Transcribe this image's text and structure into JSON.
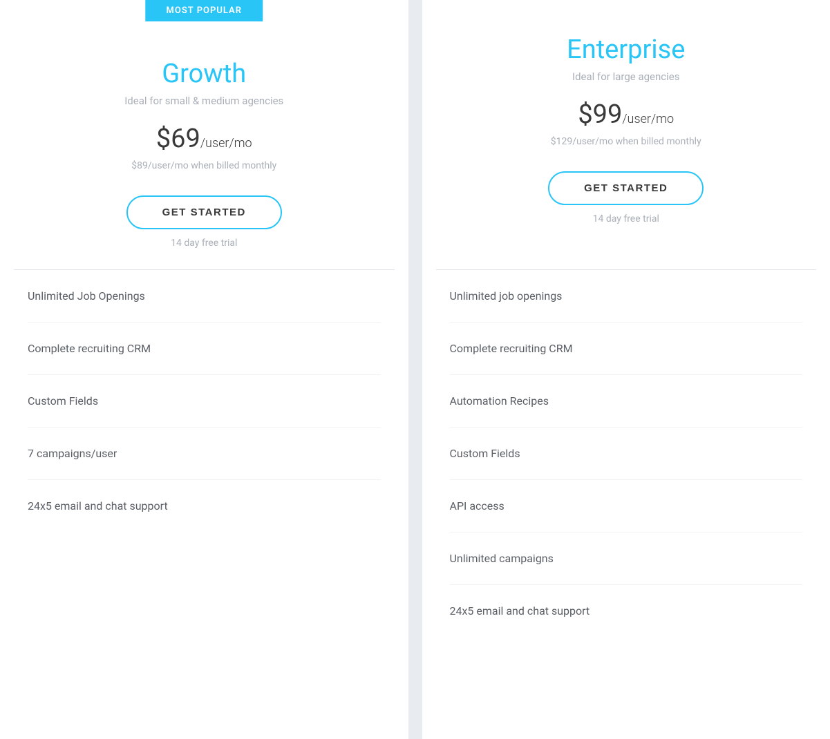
{
  "plans": [
    {
      "id": "growth",
      "name": "Growth",
      "badge": "MOST POPULAR",
      "tagline": "Ideal for small & medium agencies",
      "price": "$69",
      "period": "/user/mo",
      "billing_note": "$89/user/mo when billed monthly",
      "cta_label": "GET STARTED",
      "trial_text": "14 day free trial",
      "features": [
        "Unlimited Job Openings",
        "Complete recruiting CRM",
        "Custom Fields",
        "7 campaigns/user",
        "24x5 email and chat support"
      ]
    },
    {
      "id": "enterprise",
      "name": "Enterprise",
      "badge": null,
      "tagline": "Ideal for large agencies",
      "price": "$99",
      "period": "/user/mo",
      "billing_note": "$129/user/mo when billed monthly",
      "cta_label": "GET STARTED",
      "trial_text": "14 day free trial",
      "features": [
        "Unlimited job openings",
        "Complete recruiting CRM",
        "Automation Recipes",
        "Custom Fields",
        "API access",
        "Unlimited campaigns",
        "24x5 email and chat support"
      ]
    }
  ]
}
